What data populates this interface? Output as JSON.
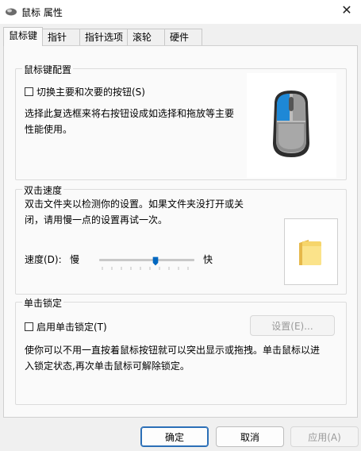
{
  "window": {
    "title": "鼠标 属性"
  },
  "tabs": [
    {
      "label": "鼠标键",
      "active": true
    },
    {
      "label": "指针",
      "active": false
    },
    {
      "label": "指针选项",
      "active": false
    },
    {
      "label": "滚轮",
      "active": false
    },
    {
      "label": "硬件",
      "active": false
    }
  ],
  "button_config": {
    "legend": "鼠标键配置",
    "checkbox_label": "切换主要和次要的按钮(S)",
    "checked": false,
    "description_line1": "选择此复选框来将右按钮设成如选择和拖放等主要",
    "description_line2": "性能使用。",
    "icon": "mouse-icon"
  },
  "double_click": {
    "legend": "双击速度",
    "description_line1": "双击文件夹以检测你的设置。如果文件夹没打开或关",
    "description_line2": "闭，请用慢一点的设置再试一次。",
    "speed_label": "速度(D):",
    "slow_label": "慢",
    "fast_label": "快",
    "speed_value_fraction": 0.6,
    "icon": "folder-icon"
  },
  "click_lock": {
    "legend": "单击锁定",
    "checkbox_label": "启用单击锁定(T)",
    "checked": false,
    "settings_button": "设置(E)...",
    "description_line1": "使你可以不用一直按着鼠标按钮就可以突出显示或拖拽。单击鼠标以进",
    "description_line2": "入锁定状态,再次单击鼠标可解除锁定。"
  },
  "footer": {
    "ok": "确定",
    "cancel": "取消",
    "apply": "应用(A)"
  },
  "colors": {
    "accent": "#0067c0",
    "primary_border": "#2b6fb7"
  }
}
